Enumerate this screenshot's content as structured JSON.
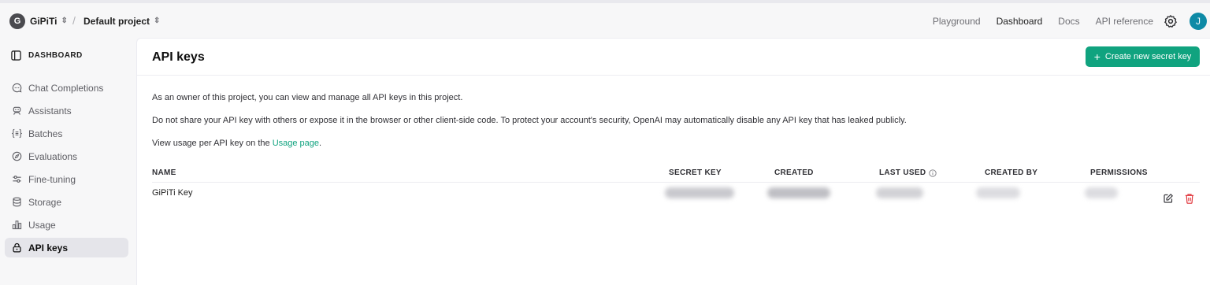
{
  "org": {
    "avatar_letter": "G",
    "name": "GiPiTi",
    "separator": "/",
    "project": "Default project"
  },
  "nav": {
    "links": [
      "Playground",
      "Dashboard",
      "Docs",
      "API reference"
    ],
    "active": "Dashboard"
  },
  "user": {
    "avatar_letter": "J",
    "avatar_color": "#0e8aa6"
  },
  "sidebar": {
    "section_title": "DASHBOARD",
    "items": [
      {
        "label": "Chat Completions",
        "icon": "chat-bubble-icon"
      },
      {
        "label": "Assistants",
        "icon": "robot-icon"
      },
      {
        "label": "Batches",
        "icon": "braces-list-icon"
      },
      {
        "label": "Evaluations",
        "icon": "compass-icon"
      },
      {
        "label": "Fine-tuning",
        "icon": "sliders-icon"
      },
      {
        "label": "Storage",
        "icon": "database-icon"
      },
      {
        "label": "Usage",
        "icon": "bar-chart-icon"
      },
      {
        "label": "API keys",
        "icon": "lock-icon",
        "active": true
      }
    ]
  },
  "main": {
    "title": "API keys",
    "create_button": "Create new secret key",
    "paragraphs": {
      "owner": "As an owner of this project, you can view and manage all API keys in this project.",
      "warning": "Do not share your API key with others or expose it in the browser or other client-side code. To protect your account's security, OpenAI may automatically disable any API key that has leaked publicly.",
      "usage_prefix": "View usage per API key on the ",
      "usage_link": "Usage page",
      "usage_suffix": "."
    },
    "table": {
      "columns": [
        "NAME",
        "SECRET KEY",
        "CREATED",
        "LAST USED",
        "CREATED BY",
        "PERMISSIONS"
      ],
      "rows": [
        {
          "name": "GiPiTi Key"
        }
      ]
    }
  },
  "colors": {
    "accent": "#10a37f",
    "danger": "#e0343a"
  }
}
